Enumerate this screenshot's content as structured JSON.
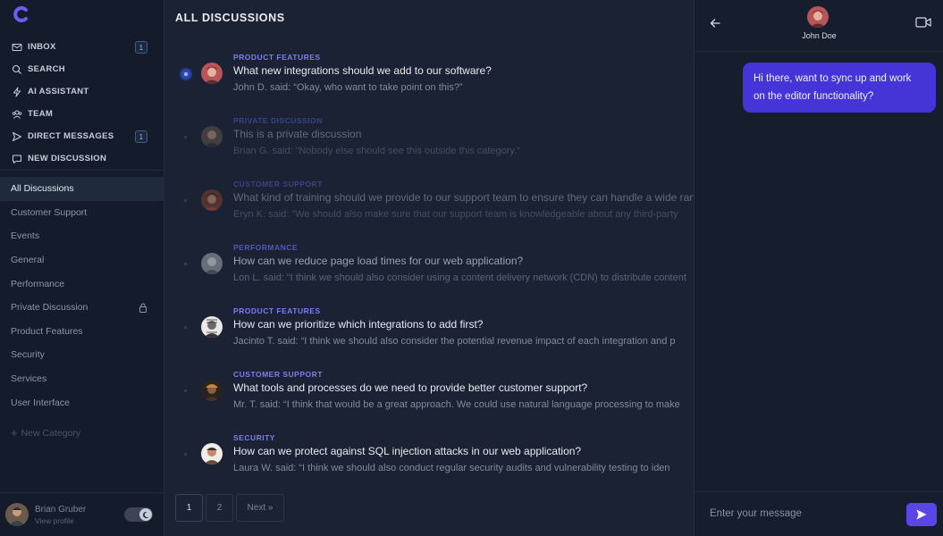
{
  "brand": {
    "logo_icon": "c-logo-icon",
    "color": "#6d5cf2"
  },
  "nav": {
    "items": [
      {
        "label": "INBOX",
        "icon": "inbox-icon",
        "badge": "1"
      },
      {
        "label": "SEARCH",
        "icon": "search-icon"
      },
      {
        "label": "AI ASSISTANT",
        "icon": "bolt-icon"
      },
      {
        "label": "TEAM",
        "icon": "team-icon"
      },
      {
        "label": "DIRECT MESSAGES",
        "icon": "send-icon",
        "badge": "1"
      },
      {
        "label": "NEW DISCUSSION",
        "icon": "chat-icon"
      }
    ]
  },
  "categories": {
    "items": [
      {
        "label": "All Discussions",
        "active": true
      },
      {
        "label": "Customer Support"
      },
      {
        "label": "Events"
      },
      {
        "label": "General"
      },
      {
        "label": "Performance"
      },
      {
        "label": "Private Discussion",
        "locked": true
      },
      {
        "label": "Product Features"
      },
      {
        "label": "Security"
      },
      {
        "label": "Services"
      },
      {
        "label": "User Interface"
      }
    ],
    "new_label": "New Category"
  },
  "profile": {
    "name": "Brian Gruber",
    "subtitle": "View profile",
    "theme_toggle_icon": "moon-icon"
  },
  "main": {
    "title": "ALL DISCUSSIONS",
    "discussions": [
      {
        "category": "PRODUCT FEATURES",
        "title": "What new integrations should we add to our software?",
        "preview": "John D. said: “Okay, who want to take point on this?”",
        "unread": true
      },
      {
        "category": "PRIVATE DISCUSSION",
        "title": "This is a private discussion",
        "preview": "Brian G. said: “Nobody else should see this outside this category.”"
      },
      {
        "category": "CUSTOMER SUPPORT",
        "title": "What kind of training should we provide to our support team to ensure they can handle a wide range of",
        "preview": "Eryn K. said: “We should also make sure that our support team is knowledgeable about any third-party"
      },
      {
        "category": "PERFORMANCE",
        "title": "How can we reduce page load times for our web application?",
        "preview": "Lon L. said: “I think we should also consider using a content delivery network (CDN) to distribute content"
      },
      {
        "category": "PRODUCT FEATURES",
        "title": "How can we prioritize which integrations to add first?",
        "preview": "Jacinto T. said: “I think we should also consider the potential revenue impact of each integration and p"
      },
      {
        "category": "CUSTOMER SUPPORT",
        "title": "What tools and processes do we need to provide better customer support?",
        "preview": "Mr. T. said: “I think that would be a great approach. We could use natural language processing to make"
      },
      {
        "category": "SECURITY",
        "title": "How can we protect against SQL injection attacks in our web application?",
        "preview": "Laura W. said: “I think we should also conduct regular security audits and vulnerability testing to iden"
      }
    ],
    "pagination": {
      "pages": [
        "1",
        "2"
      ],
      "current": "1",
      "next_label": "Next »"
    }
  },
  "chat": {
    "contact_name": "John Doe",
    "messages": [
      {
        "from": "me",
        "text": "Hi there, want to sync up and work on the editor functionality?"
      }
    ],
    "input_placeholder": "Enter your message",
    "accent": "#4534d8"
  }
}
